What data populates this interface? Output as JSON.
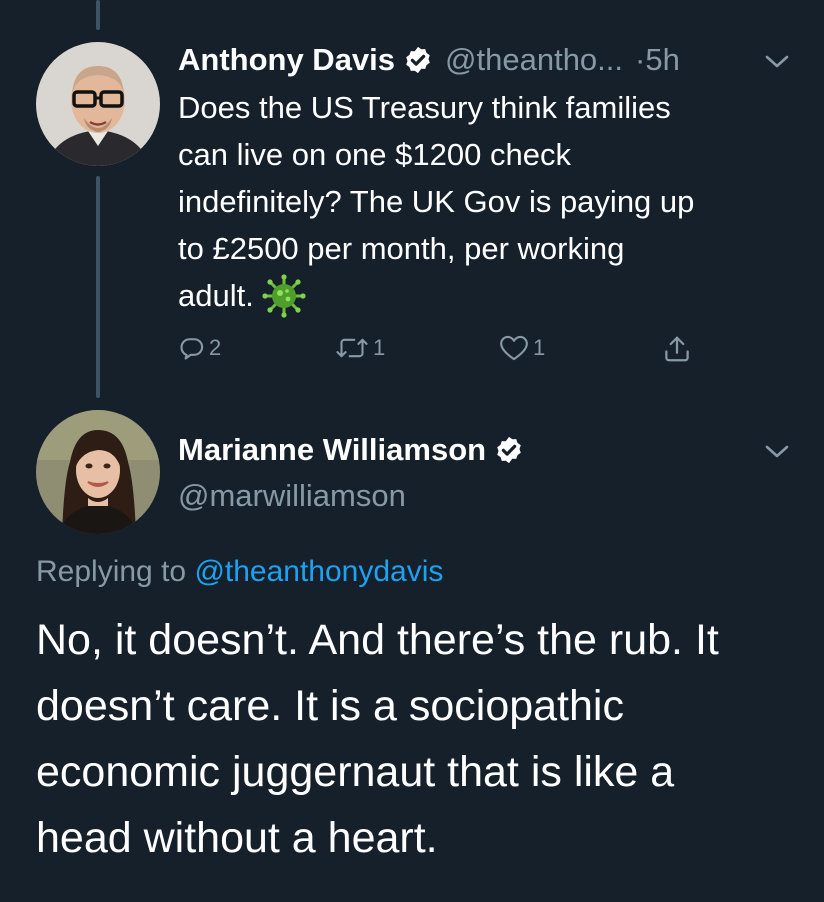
{
  "tweet1": {
    "name": "Anthony Davis",
    "handle": "@theantho...",
    "time": "·5h",
    "text_lines": [
      "Does the US Treasury think families",
      "can live on one $1200 check",
      "indefinitely? The UK Gov is paying up",
      "to £2500 per month, per working",
      "adult."
    ],
    "emoji": "virus-emoji",
    "reply_count": "2",
    "retweet_count": "1",
    "like_count": "1"
  },
  "tweet2": {
    "name": "Marianne Williamson",
    "handle": "@marwilliamson",
    "replying_prefix": "Replying to",
    "replying_handle": "@theanthonydavis",
    "text_lines": [
      "No, it doesn’t. And there’s the rub. It",
      "doesn’t care. It is a sociopathic",
      "economic juggernaut that is like a",
      "head without a heart."
    ]
  },
  "colors": {
    "background": "#15202b",
    "secondary_text": "#8899a6",
    "accent": "#1da1f2",
    "thread_line": "#3d5466"
  }
}
